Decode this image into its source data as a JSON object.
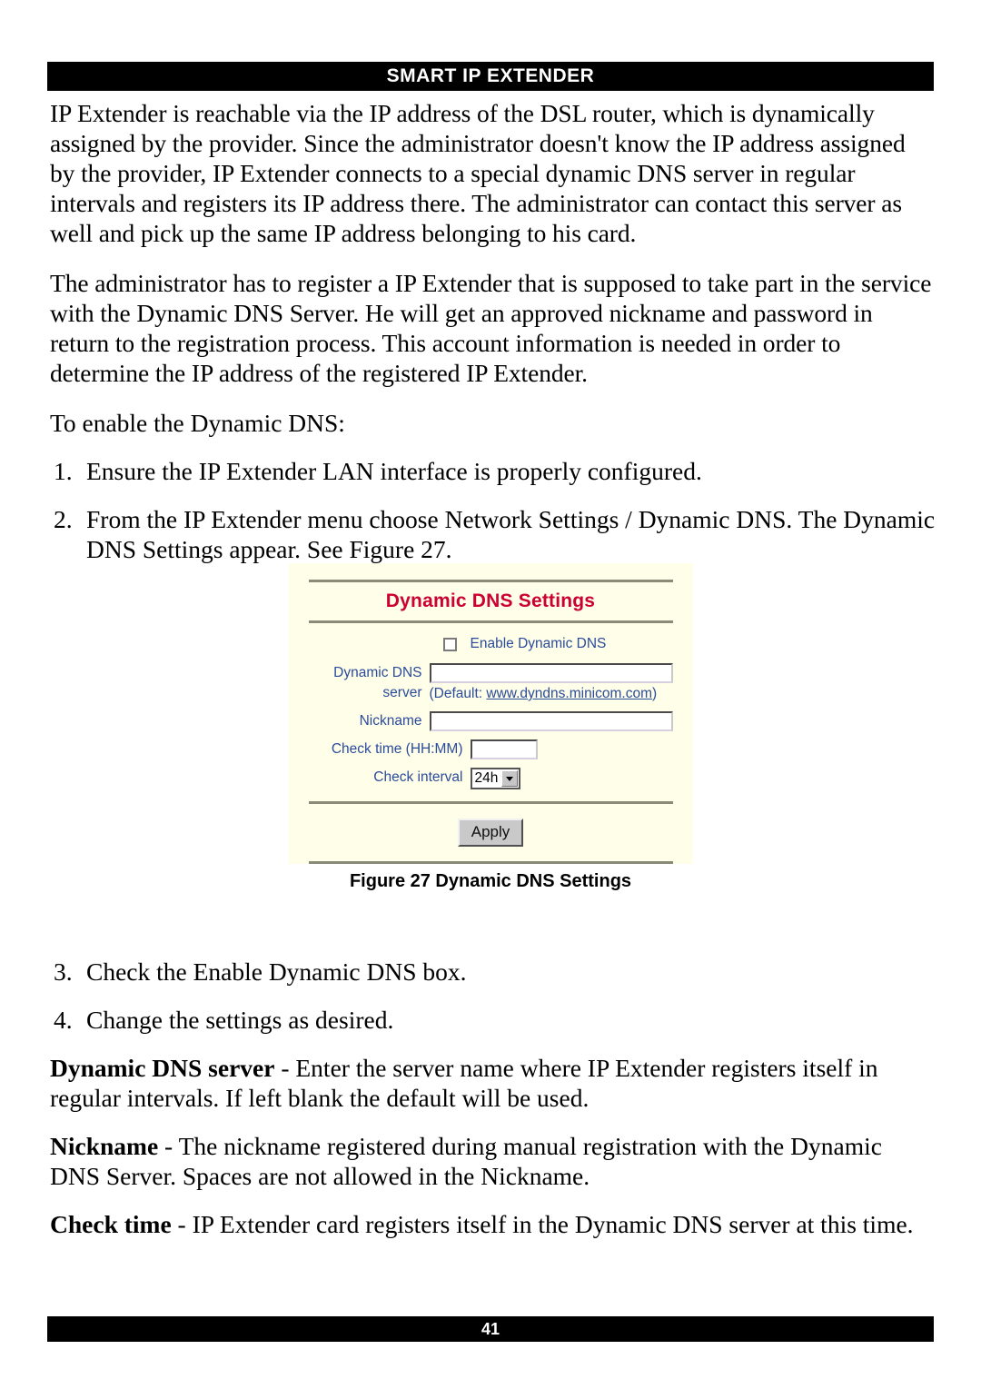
{
  "header": {
    "title": "SMART IP EXTENDER"
  },
  "body": {
    "paragraph1": "IP Extender is reachable via the IP address of the DSL router, which is dynamically assigned by the provider. Since the administrator doesn't know the IP address assigned by the provider, IP Extender connects to a special dynamic DNS server in regular intervals and registers its IP address there. The administrator can contact this server as well and pick up the same IP address belonging to his card.",
    "paragraph2": "The administrator has to register a IP Extender that is supposed to take part in the service with the Dynamic DNS Server. He will get an approved nickname and password in return to the registration process. This account information is needed in order to determine the IP address of the registered IP Extender.",
    "lead": "To enable the Dynamic DNS:",
    "steps": [
      {
        "num": "1.",
        "text": "Ensure the IP Extender LAN interface is properly configured."
      },
      {
        "num": "2.",
        "text": "From the IP Extender menu choose Network Settings / Dynamic DNS. The Dynamic DNS Settings appear. See Figure 27."
      },
      {
        "num": "3.",
        "text": "Check the Enable Dynamic DNS box."
      },
      {
        "num": "4.",
        "text": "Change the settings as desired."
      }
    ],
    "definitions": [
      {
        "term": "Dynamic DNS server",
        "dash": " - ",
        "text": "Enter the server name where IP Extender registers itself in regular intervals. If left blank the default will be used."
      },
      {
        "term": "Nickname",
        "dash": " - ",
        "text": "The nickname registered during manual registration with the Dynamic DNS Server. Spaces are not allowed in the Nickname."
      },
      {
        "term": "Check time",
        "dash": " - ",
        "text": "IP Extender card registers itself in the Dynamic DNS server at this time."
      }
    ]
  },
  "figure": {
    "caption": "Figure 27 Dynamic DNS Settings",
    "dialog": {
      "title": "Dynamic DNS Settings",
      "title_color": "#cc0033",
      "background_color": "#fffee8",
      "label_color": "#2b4b9b",
      "enable_checkbox": {
        "label": "Enable Dynamic DNS",
        "checked": false
      },
      "fields": [
        {
          "label": "Dynamic DNS server",
          "value": "",
          "hint_prefix": "(Default: ",
          "hint_link": "www.dyndns.minicom.com",
          "hint_suffix": ")"
        },
        {
          "label": "Nickname",
          "value": ""
        },
        {
          "label": "Check time (HH:MM)",
          "value": ""
        }
      ],
      "check_interval": {
        "label": "Check interval",
        "selected": "24h"
      },
      "apply_button": "Apply"
    }
  },
  "footer": {
    "page_number": "41"
  }
}
